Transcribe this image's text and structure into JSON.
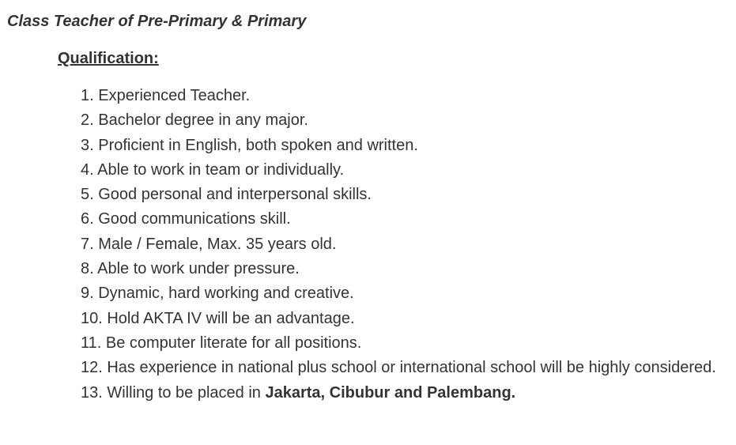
{
  "job_title": "Class Teacher of Pre-Primary & Primary",
  "qualification_heading": "Qualification:",
  "qualifications": [
    "1. Experienced Teacher.",
    "2. Bachelor degree in any major.",
    "3. Proficient in English, both spoken and written.",
    "4. Able to work in team or individually.",
    "5. Good personal and interpersonal skills.",
    "6. Good communications skill.",
    "7. Male / Female, Max. 35 years old.",
    "8. Able to work under pressure.",
    "9. Dynamic, hard working and creative.",
    "10. Hold AKTA IV will be an advantage.",
    "11. Be computer literate for all positions.",
    "12. Has experience in national plus school or international school will be highly considered."
  ],
  "last_item": {
    "prefix": "13. Willing to be placed in ",
    "locations": "Jakarta, Cibubur and Palembang."
  }
}
